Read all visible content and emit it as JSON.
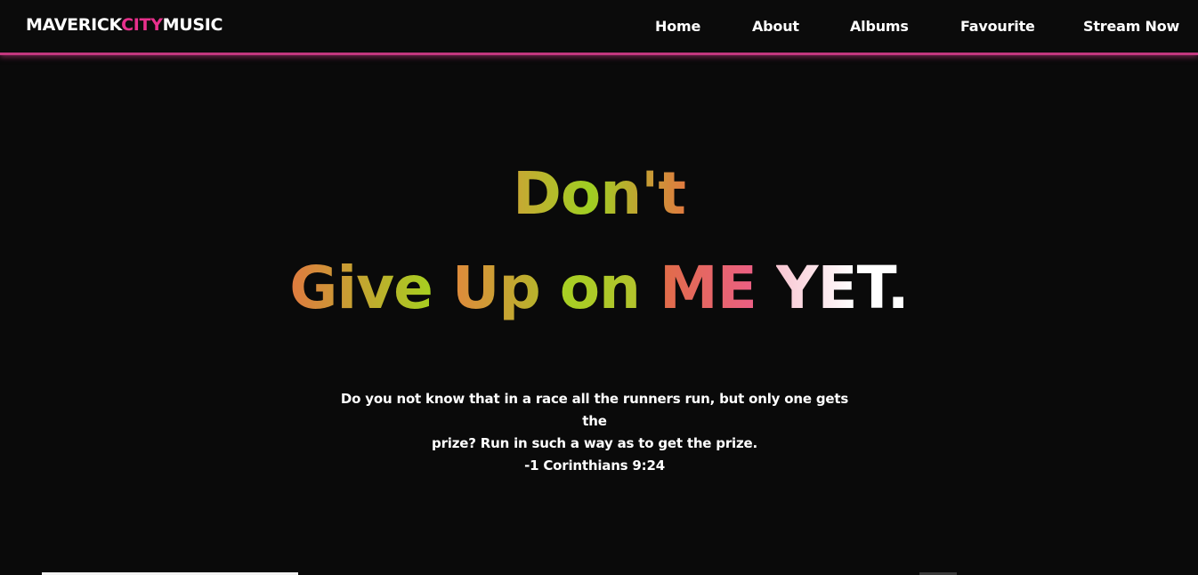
{
  "brand": {
    "part1": "MAVERICK",
    "part2": "CITY",
    "part3": "MUSIC",
    "accent_color": "#e8308c"
  },
  "nav": {
    "items": [
      {
        "label": "Home"
      },
      {
        "label": "About"
      },
      {
        "label": "Albums"
      },
      {
        "label": "Favourite"
      },
      {
        "label": "Stream Now"
      }
    ],
    "underline_color": "#c2377e"
  },
  "hero": {
    "line1": "Don't",
    "line2_words": [
      "Give",
      "Up",
      "on",
      "ME",
      "YET."
    ]
  },
  "verse": {
    "line1": "Do you not know that in a race all the runners run, but only one gets the",
    "line2": "prize? Run in such a way as to get the prize.",
    "reference": "-1 Corinthians 9:24"
  },
  "colors": {
    "background": "#0a0a0a",
    "text": "#ffffff"
  }
}
